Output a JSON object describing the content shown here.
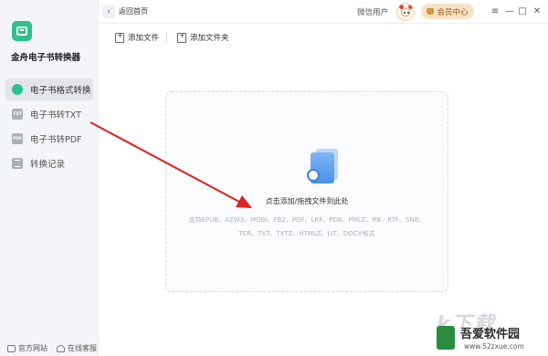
{
  "app": {
    "title": "金舟电子书转换器"
  },
  "sidebar": {
    "items": [
      {
        "label": "电子书格式转换",
        "icon": "convert-icon",
        "active": true
      },
      {
        "label": "电子书转TXT",
        "icon": "txt-icon",
        "icon_text": "TXT",
        "active": false
      },
      {
        "label": "电子书转PDF",
        "icon": "pdf-icon",
        "icon_text": "PDF",
        "active": false
      },
      {
        "label": "转换记录",
        "icon": "history-icon",
        "active": false
      }
    ],
    "footer": {
      "website": "官方网站",
      "support": "在线客服"
    }
  },
  "topbar": {
    "back_label": "返回首页",
    "back_glyph": "‹",
    "user_name": "微信用户",
    "vip_label": "会员中心",
    "controls": {
      "settings": "≡",
      "minimize": "—",
      "maximize": "□",
      "close": "✕"
    }
  },
  "toolbar": {
    "add_file": "添加文件",
    "add_folder": "添加文件夹"
  },
  "dropzone": {
    "main_text": "点击添加/拖拽文件到此处",
    "formats_line1": "支持EPUB、AZW3、MOBI、FB2、PDF、LRF、PDB、PMLZ、RB、RTF、SNB、",
    "formats_line2": "TCR、TXT、TXTZ、HTMLZ、LIT、DOCX格式"
  },
  "watermark": {
    "fade_text": "k下载",
    "name": "吾爱软件园",
    "url": "www.52zxue.com"
  },
  "colors": {
    "accent": "#2ec28b",
    "vip_bg": "#f6e3c7",
    "arrow": "#e02020"
  }
}
